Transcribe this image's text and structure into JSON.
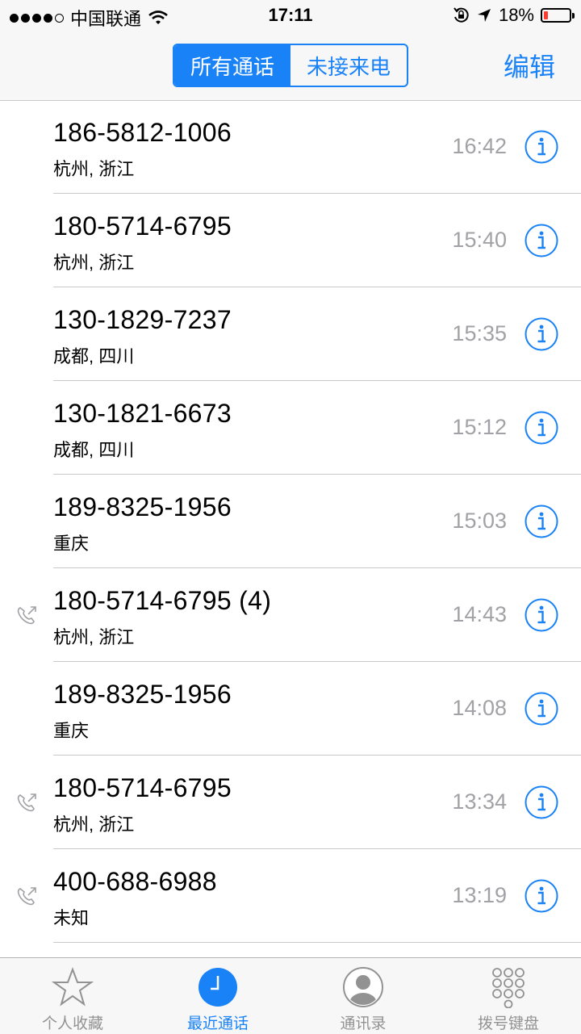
{
  "status": {
    "carrier": "中国联通",
    "time": "17:11",
    "battery": "18%",
    "battery_level": 0.18,
    "icons": [
      "signal-dots",
      "wifi-icon",
      "rotation-lock-icon",
      "location-arrow-icon",
      "battery-icon"
    ]
  },
  "nav": {
    "segments": [
      "所有通话",
      "未接来电"
    ],
    "selected_segment": 0,
    "edit_label": "编辑",
    "accent_color": "#1a82f7"
  },
  "calls": [
    {
      "number": "186-5812-1006",
      "location": "杭州, 浙江",
      "time": "16:42",
      "outgoing": false
    },
    {
      "number": "180-5714-6795",
      "location": "杭州, 浙江",
      "time": "15:40",
      "outgoing": false
    },
    {
      "number": "130-1829-7237",
      "location": "成都, 四川",
      "time": "15:35",
      "outgoing": false
    },
    {
      "number": "130-1821-6673",
      "location": "成都, 四川",
      "time": "15:12",
      "outgoing": false
    },
    {
      "number": "189-8325-1956",
      "location": "重庆",
      "time": "15:03",
      "outgoing": false
    },
    {
      "number": "180-5714-6795 (4)",
      "location": "杭州, 浙江",
      "time": "14:43",
      "outgoing": true
    },
    {
      "number": "189-8325-1956",
      "location": "重庆",
      "time": "14:08",
      "outgoing": false
    },
    {
      "number": "180-5714-6795",
      "location": "杭州, 浙江",
      "time": "13:34",
      "outgoing": true
    },
    {
      "number": "400-688-6988",
      "location": "未知",
      "time": "13:19",
      "outgoing": true
    }
  ],
  "tabs": [
    {
      "label": "个人收藏",
      "icon": "star-icon"
    },
    {
      "label": "最近通话",
      "icon": "clock-icon"
    },
    {
      "label": "通讯录",
      "icon": "contact-icon"
    },
    {
      "label": "拨号键盘",
      "icon": "keypad-icon"
    }
  ],
  "active_tab": 1
}
